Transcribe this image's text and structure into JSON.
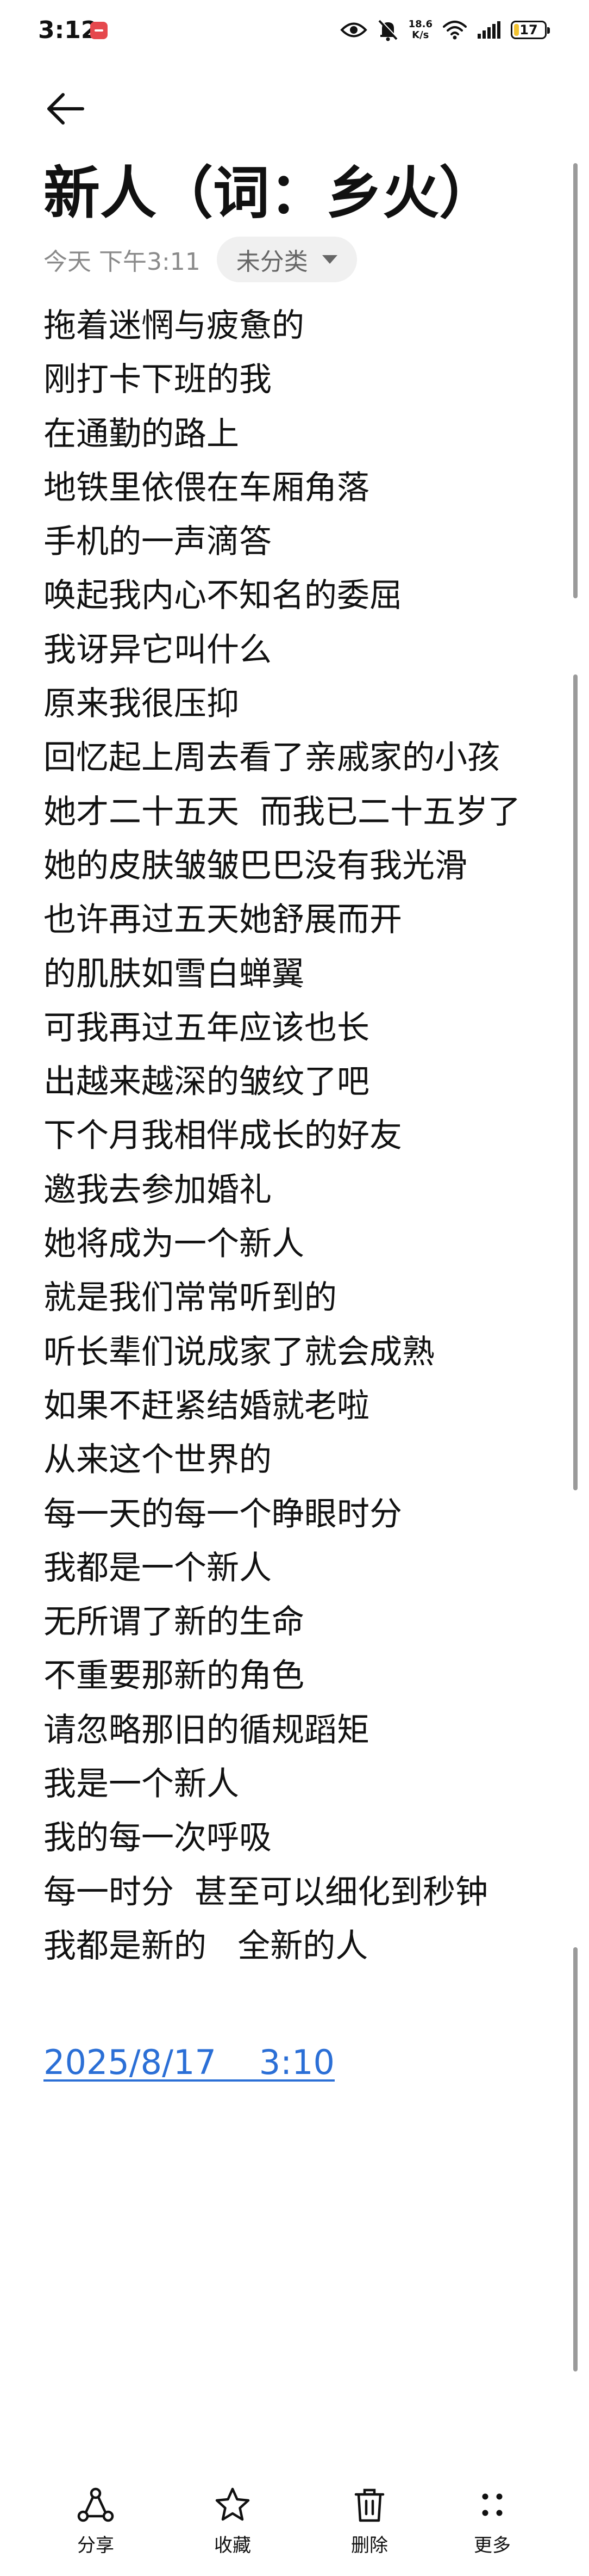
{
  "status_bar": {
    "time": "3:12",
    "net_speed_value": "18.6",
    "net_speed_unit": "K/s",
    "battery_level": "17",
    "battery_percent": 17
  },
  "header": {
    "title": "新人（词：乡火）",
    "date": "今天 下午3:11",
    "category": "未分类"
  },
  "lyrics": [
    "拖着迷惘与疲惫的",
    "刚打卡下班的我",
    "在通勤的路上",
    "地铁里依偎在车厢角落",
    "手机的一声滴答",
    "唤起我内心不知名的委屈",
    "我讶异它叫什么",
    "原来我很压抑",
    "回忆起上周去看了亲戚家的小孩",
    "她才二十五天  而我已二十五岁了",
    "她的皮肤皱皱巴巴没有我光滑",
    "也许再过五天她舒展而开",
    "的肌肤如雪白蝉翼",
    "可我再过五年应该也长",
    "出越来越深的皱纹了吧",
    "下个月我相伴成长的好友",
    "邀我去参加婚礼",
    "她将成为一个新人",
    "就是我们常常听到的",
    "听长辈们说成家了就会成熟",
    "如果不赶紧结婚就老啦",
    "从来这个世界的",
    "每一天的每一个睁眼时分",
    "我都是一个新人",
    "无所谓了新的生命",
    "不重要那新的角色",
    "请忽略那旧的循规蹈矩",
    "我是一个新人",
    "我的每一次呼吸",
    "每一时分  甚至可以细化到秒钟",
    "我都是新的   全新的人"
  ],
  "footer_date": "2025/8/17    3:10",
  "toolbar": {
    "share": "分享",
    "favorite": "收藏",
    "delete": "删除",
    "more": "更多"
  },
  "icons": {
    "back": "back-arrow-icon",
    "share": "share-icon",
    "favorite": "star-icon",
    "delete": "trash-icon",
    "more": "more-dots-icon"
  },
  "colors": {
    "link": "#2b6fd6",
    "battery": "#f2c230",
    "badge": "#e5484d"
  }
}
